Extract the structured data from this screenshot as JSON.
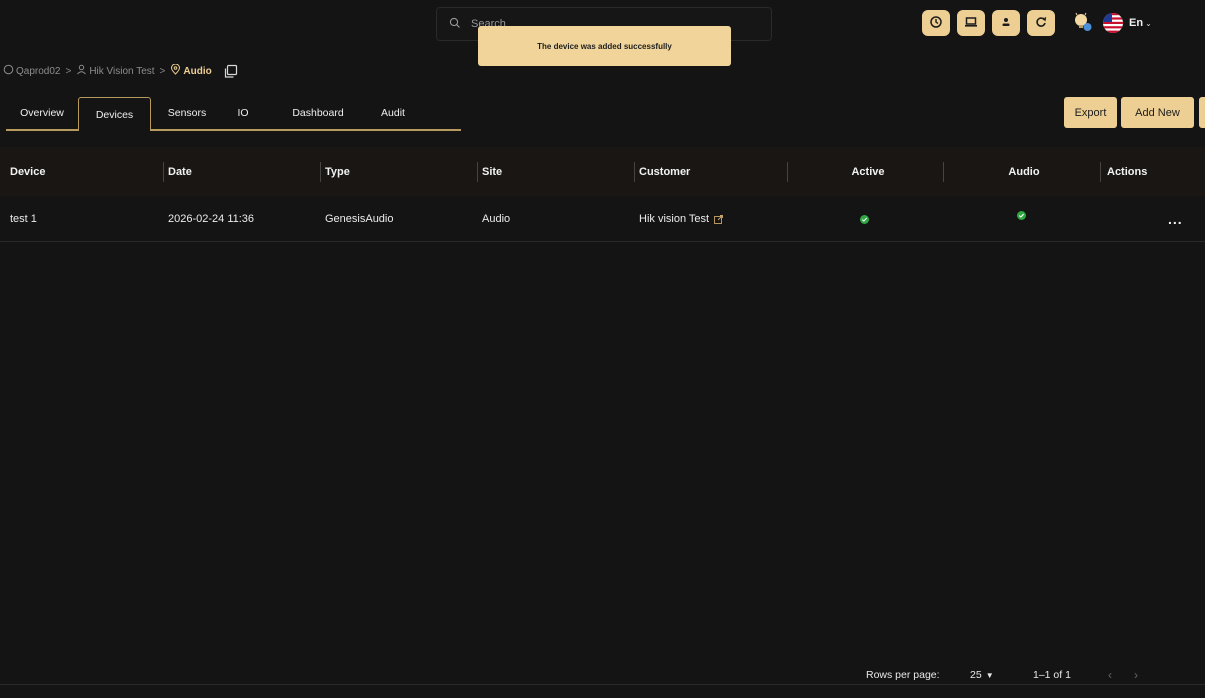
{
  "search": {
    "placeholder": "Search"
  },
  "toast": {
    "message": "The device was added successfully"
  },
  "topbar": {
    "icons": [
      "clock-icon",
      "laptop-icon",
      "user-icon",
      "refresh-icon"
    ],
    "language": "En"
  },
  "breadcrumb": {
    "items": [
      {
        "label": "Qaprod02",
        "icon": "building-icon"
      },
      {
        "label": "Hik Vision Test",
        "icon": "person-icon"
      },
      {
        "label": "Audio",
        "icon": "location-pin-icon",
        "current": true
      }
    ]
  },
  "tabs": [
    {
      "label": "Overview"
    },
    {
      "label": "Devices",
      "active": true
    },
    {
      "label": "Sensors"
    },
    {
      "label": "IO"
    },
    {
      "label": "Dashboard"
    },
    {
      "label": "Audit"
    }
  ],
  "toolbar": {
    "export_label": "Export",
    "add_new_label": "Add New"
  },
  "table": {
    "headers": [
      "Device",
      "Date",
      "Type",
      "Site",
      "Customer",
      "Active",
      "Audio",
      "Actions"
    ],
    "rows": [
      {
        "device": "test 1",
        "date": "2026-02-24 11:36",
        "type": "GenesisAudio",
        "site": "Audio",
        "customer": "Hik vision Test",
        "active": true,
        "audio": true,
        "actions": "..."
      }
    ]
  },
  "pagination": {
    "rows_per_page_label": "Rows per page:",
    "rows_per_page": "25",
    "range": "1–1 of 1"
  },
  "colors": {
    "accent": "#eecf93",
    "background": "#141414",
    "header_bg": "#1a1613",
    "success": "#2fa742"
  }
}
